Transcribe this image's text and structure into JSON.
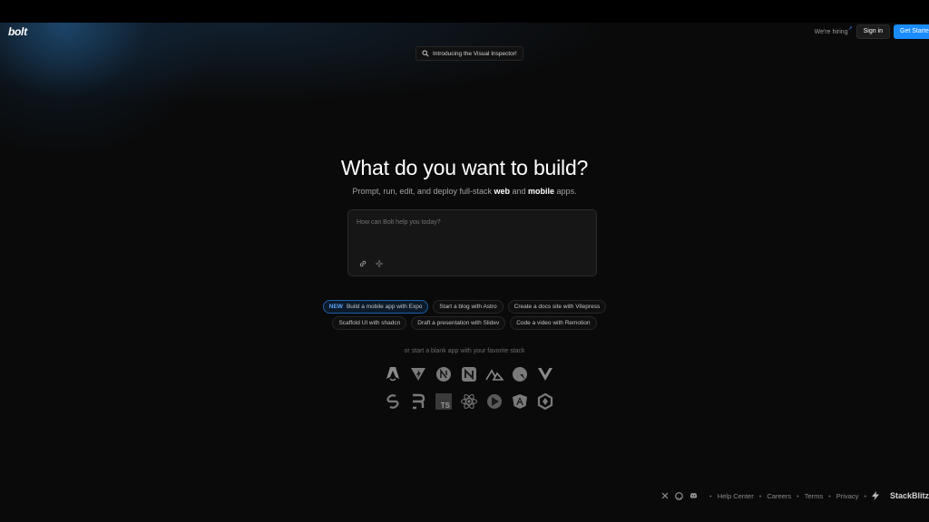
{
  "brand": {
    "logo_text": "bolt"
  },
  "header": {
    "hiring_label": "We're hiring",
    "signin_label": "Sign in",
    "get_started_label": "Get Started"
  },
  "announcement": {
    "label": "Introducing the Visual Inspector!"
  },
  "hero": {
    "headline": "What do you want to build?",
    "sub_prefix": "Prompt, run, edit, and deploy full-stack ",
    "sub_web": "web",
    "sub_and": " and ",
    "sub_mobile": "mobile",
    "sub_suffix": " apps."
  },
  "prompt": {
    "placeholder": "How can Bolt help you today?",
    "attach_icon": "link-icon",
    "enhance_icon": "sparkle-icon"
  },
  "suggestions": {
    "new_badge": "NEW",
    "row1": [
      "Build a mobile app with Expo",
      "Start a blog with Astro",
      "Create a docs site with Vitepress"
    ],
    "row2": [
      "Scaffold UI with shadcn",
      "Draft a presentation with Slidev",
      "Code a video with Remotion"
    ]
  },
  "stacks": {
    "caption": "or start a blank app with your favorite stack",
    "row1": [
      "astro-icon",
      "vite-icon",
      "next-icon",
      "nuxt-icon",
      "nativescript-icon",
      "qwik-icon",
      "vue-icon"
    ],
    "row2": [
      "svelte-icon",
      "remix-icon",
      "typescript-icon",
      "react-icon",
      "slidev-icon",
      "angular-icon",
      "solid-icon"
    ],
    "typescript_text": "TS"
  },
  "footer": {
    "icons": [
      "x-icon",
      "github-icon",
      "discord-icon"
    ],
    "links": [
      "Help Center",
      "Careers",
      "Terms",
      "Privacy"
    ],
    "separator": "•",
    "brand_text": "StackBlitz"
  },
  "colors": {
    "background": "#0a0a0a",
    "accent": "#1a8cff",
    "chip_new": "#60a5fa"
  }
}
